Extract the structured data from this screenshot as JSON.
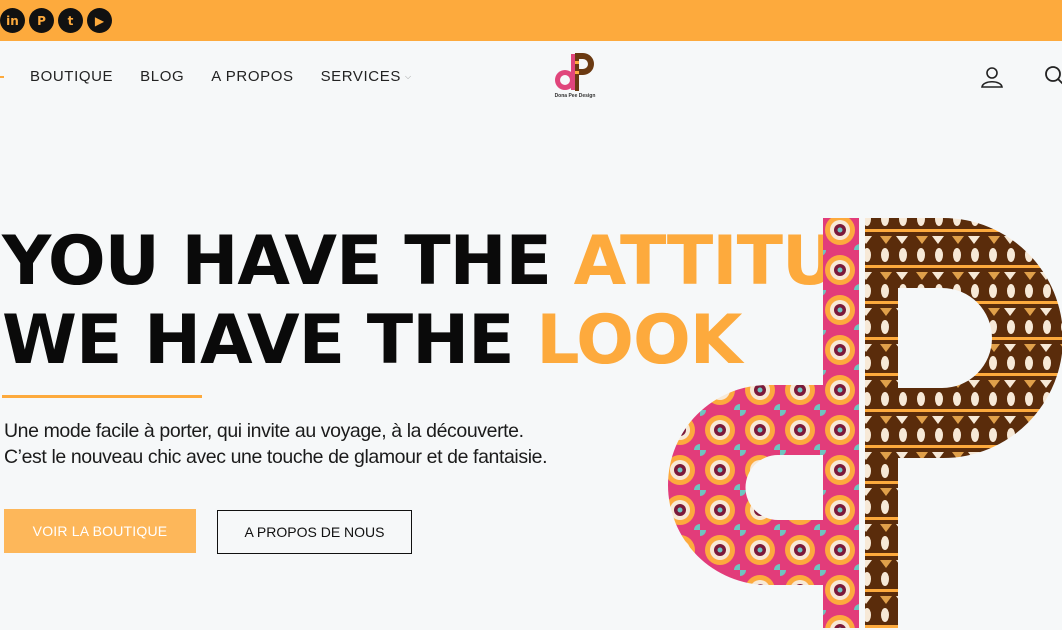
{
  "social": [
    {
      "name": "linkedin-icon",
      "glyph": "in"
    },
    {
      "name": "pinterest-icon",
      "glyph": "P"
    },
    {
      "name": "twitter-icon",
      "glyph": "t"
    },
    {
      "name": "youtube-icon",
      "glyph": "▶"
    }
  ],
  "nav": {
    "items": [
      {
        "label": "BOUTIQUE"
      },
      {
        "label": "BLOG"
      },
      {
        "label": "A PROPOS"
      },
      {
        "label": "SERVICES"
      }
    ],
    "logo_text": "Dona Pee Design"
  },
  "hero": {
    "line1_plain": "YOU HAVE THE ",
    "line1_highlight": "ATTITUDE",
    "line2_plain": "WE HAVE THE ",
    "line2_highlight": "LOOK",
    "subtitle_line1": "Une mode facile à porter, qui invite au voyage, à la découverte.",
    "subtitle_line2": "C’est le nouveau chic avec une touche de glamour et de fantaisie.",
    "primary_button": "VOIR LA BOUTIQUE",
    "secondary_button": "A PROPOS DE NOUS"
  },
  "colors": {
    "accent": "#fdaa3d",
    "text": "#0a0a0a",
    "background": "#f6f8f9"
  }
}
